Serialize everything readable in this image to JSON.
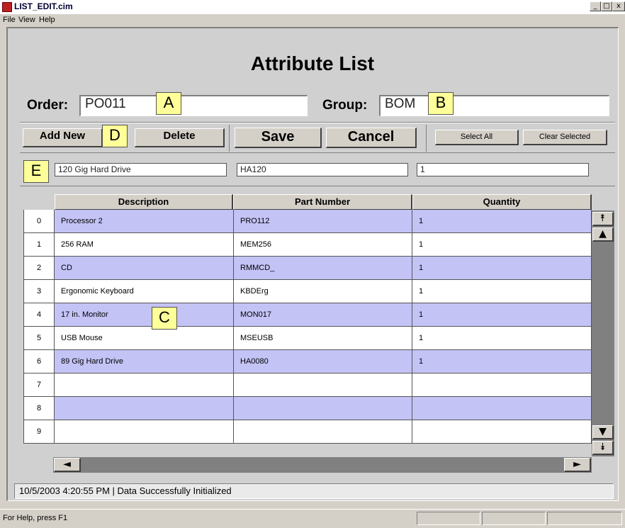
{
  "window": {
    "title": "LIST_EDIT.cim",
    "min": "_",
    "max": "□",
    "close": "x"
  },
  "menu": [
    "File",
    "View",
    "Help"
  ],
  "heading": "Attribute List",
  "order": {
    "label": "Order:",
    "value": "PO011"
  },
  "group": {
    "label": "Group:",
    "value": "BOM"
  },
  "callouts": {
    "a": "A",
    "b": "B",
    "c": "C",
    "d": "D",
    "e": "E"
  },
  "buttons": {
    "add_new": "Add New",
    "delete": "Delete",
    "save": "Save",
    "cancel": "Cancel",
    "select_all": "Select All",
    "clear_selected": "Clear Selected"
  },
  "editor": {
    "description": "120 Gig Hard Drive",
    "part_number": "HA120",
    "quantity": "1"
  },
  "table": {
    "headers": [
      "Description",
      "Part Number",
      "Quantity"
    ],
    "rows": [
      {
        "idx": "0",
        "description": "Processor 2",
        "part_number": "PRO112",
        "quantity": "1"
      },
      {
        "idx": "1",
        "description": "256 RAM",
        "part_number": "MEM256",
        "quantity": "1"
      },
      {
        "idx": "2",
        "description": "CD",
        "part_number": "RMMCD_",
        "quantity": "1"
      },
      {
        "idx": "3",
        "description": "Ergonomic Keyboard",
        "part_number": "KBDErg",
        "quantity": "1"
      },
      {
        "idx": "4",
        "description": "17 in. Monitor",
        "part_number": "MON017",
        "quantity": "1"
      },
      {
        "idx": "5",
        "description": "USB Mouse",
        "part_number": "MSEUSB",
        "quantity": "1"
      },
      {
        "idx": "6",
        "description": "89 Gig Hard Drive",
        "part_number": "HA0080",
        "quantity": "1"
      },
      {
        "idx": "7",
        "description": "",
        "part_number": "",
        "quantity": ""
      },
      {
        "idx": "8",
        "description": "",
        "part_number": "",
        "quantity": ""
      },
      {
        "idx": "9",
        "description": "",
        "part_number": "",
        "quantity": ""
      }
    ]
  },
  "scroll": {
    "top": "⯭",
    "up": "▲",
    "down": "▼",
    "bottom": "⯯",
    "left": "◄",
    "right": "►"
  },
  "status": "10/5/2003 4:20:55 PM |  Data Successfully Initialized",
  "helpbar": "For Help, press F1"
}
